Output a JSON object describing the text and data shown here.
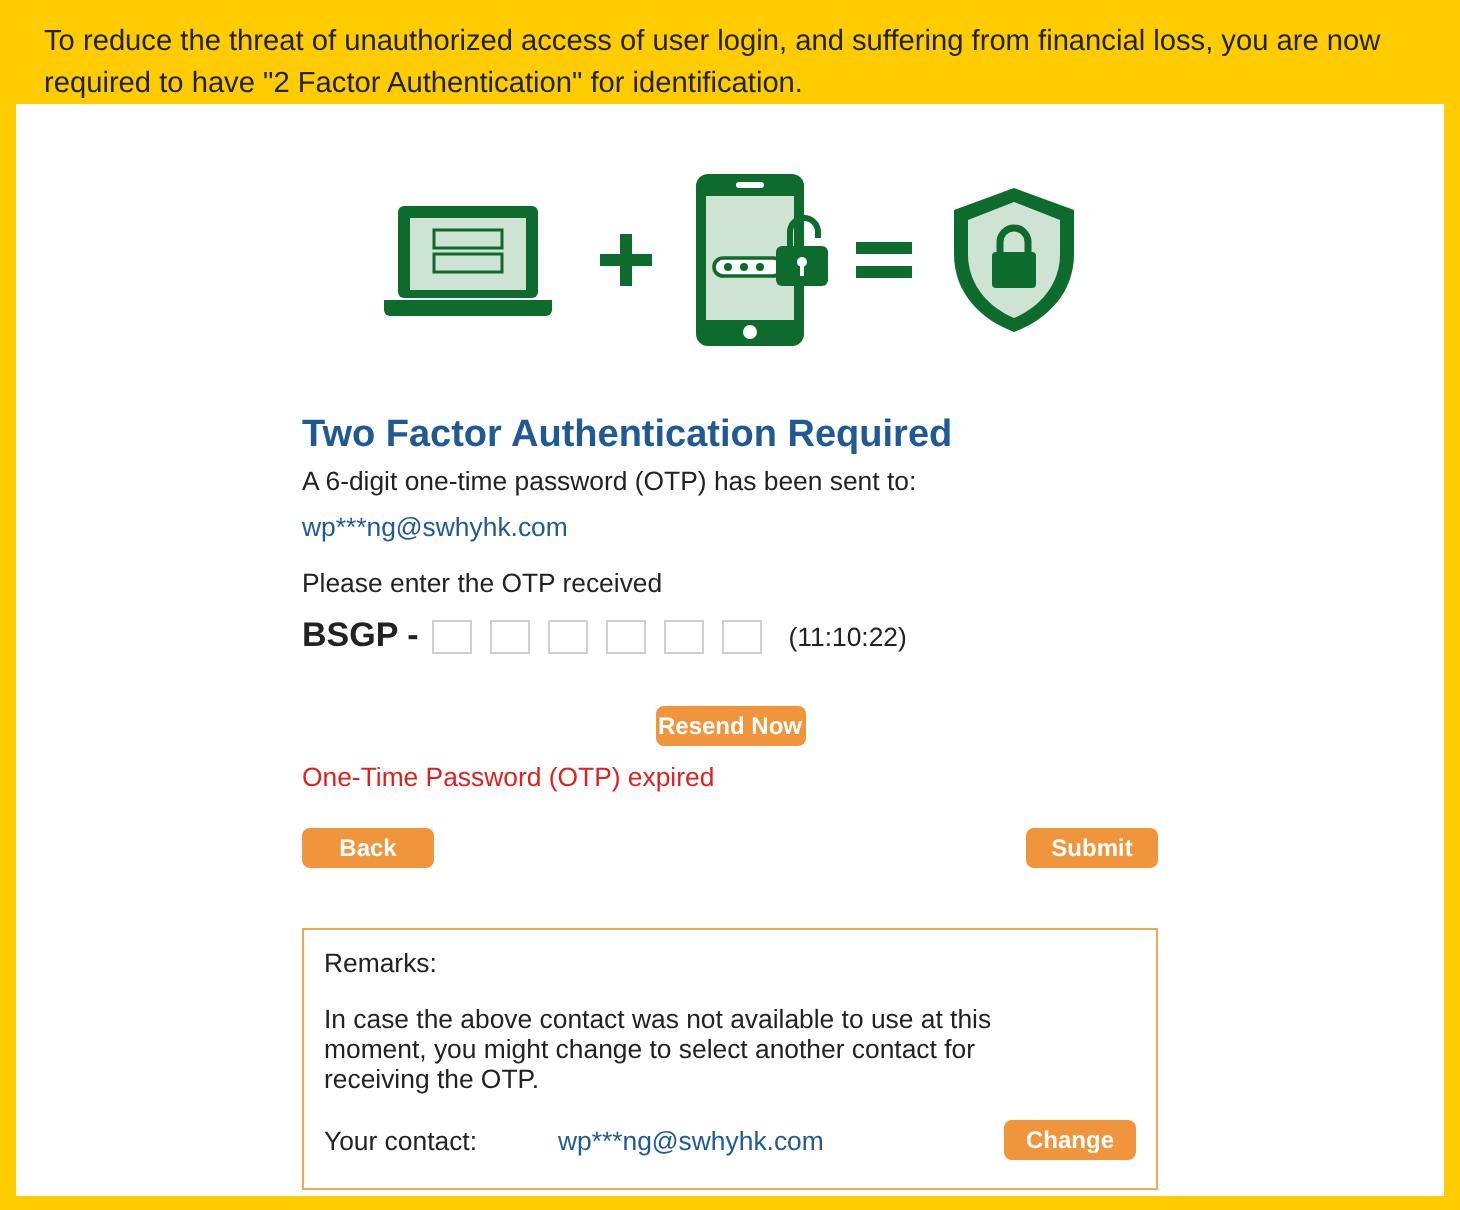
{
  "banner": {
    "text": "To reduce the threat of unauthorized access of user login, and suffering from financial loss, you are now required to have \"2 Factor Authentication\" for identification."
  },
  "form": {
    "title": "Two Factor Authentication Required",
    "sent_notice": "A 6-digit one-time password (OTP) has been sent to:",
    "email": "wp***ng@swhyhk.com",
    "prompt": "Please enter the OTP received",
    "otp_prefix": "BSGP -",
    "otp_fields": [
      {
        "kind": "digit"
      },
      {
        "kind": "digit"
      },
      {
        "kind": "digit"
      },
      {
        "kind": "digit"
      },
      {
        "kind": "digit"
      },
      {
        "kind": "digit"
      }
    ],
    "timer": "(11:10:22)",
    "resend_button": "Resend Now",
    "error": "One-Time Password (OTP) expired",
    "back_button": "Back",
    "submit_button": "Submit"
  },
  "remarks": {
    "heading": "Remarks:",
    "text": "In case the above contact was not available to use at this moment, you might change to select another contact for receiving the OTP.",
    "contact_label": "Your contact:",
    "contact": "wp***ng@swhyhk.com",
    "change_button": "Change"
  }
}
